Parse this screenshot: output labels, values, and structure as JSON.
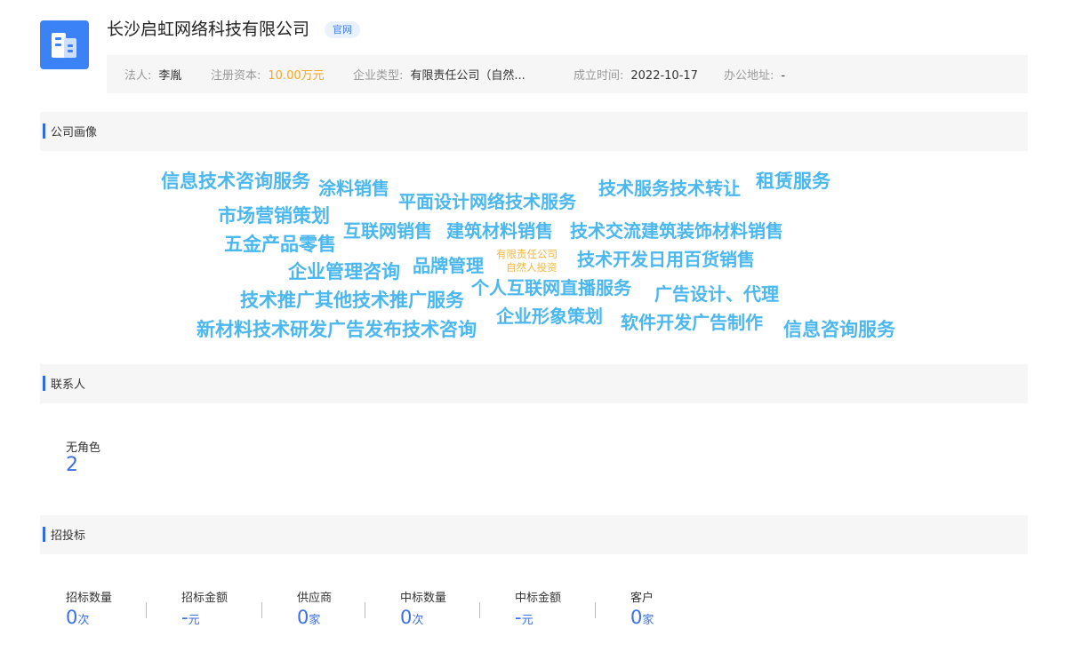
{
  "company": {
    "name": "长沙启虹网络科技有限公司",
    "badge": "官网",
    "logo_icon": "building-icon",
    "accent_color": "#3b82f6"
  },
  "info": [
    {
      "label": "法人:",
      "value": "李胤"
    },
    {
      "label": "注册资本:",
      "value": "10.00万元"
    },
    {
      "label": "企业类型:",
      "value": "有限责任公司（自然..."
    },
    {
      "label": "成立时间:",
      "value": "2022-10-17"
    },
    {
      "label": "办公地址:",
      "value": "-"
    }
  ],
  "sections": {
    "portrait": "公司画像",
    "contacts": "联系人",
    "bidding": "招投标"
  },
  "word_cloud": [
    "信息技术咨询服务",
    "涂料销售",
    "平面设计网络技术服务",
    "技术服务技术转让",
    "租赁服务",
    "市场营销策划",
    "互联网销售",
    "建筑材料销售",
    "技术交流建筑装饰材料销售",
    "五金产品零售",
    "企业管理咨询",
    "品牌管理",
    "有限责任公司",
    "自然人投资",
    "技术开发日用百货销售",
    "技术推广其他技术推广服务",
    "个人互联网直播服务",
    "广告设计、代理",
    "新材料技术研发广告发布技术咨询",
    "企业形象策划",
    "软件开发广告制作",
    "信息咨询服务"
  ],
  "contacts": {
    "label": "无角色",
    "value": "2"
  },
  "bidding": [
    {
      "label": "招标数量",
      "value": "0",
      "unit": "次"
    },
    {
      "label": "招标金额",
      "value": "-",
      "unit": "元"
    },
    {
      "label": "供应商",
      "value": "0",
      "unit": "家"
    },
    {
      "label": "中标数量",
      "value": "0",
      "unit": "次"
    },
    {
      "label": "中标金额",
      "value": "-",
      "unit": "元"
    },
    {
      "label": "客户",
      "value": "0",
      "unit": "家"
    }
  ]
}
